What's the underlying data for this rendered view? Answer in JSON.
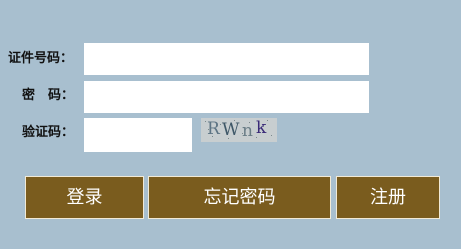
{
  "form": {
    "id_number_label": "证件号码：",
    "password_label": "密　码：",
    "captcha_label": "验证码：",
    "id_number_value": "",
    "password_value": "",
    "captcha_value": ""
  },
  "captcha_image": {
    "text": "RWnk",
    "chars": [
      "R",
      "W",
      "n",
      "k"
    ],
    "colors": [
      "#5d7484",
      "#3f5868",
      "#6a7d86",
      "#3a2a78"
    ]
  },
  "buttons": {
    "login_label": "登录",
    "forgot_password_label": "忘记密码",
    "register_label": "注册"
  },
  "colors": {
    "background": "#a8bfcf",
    "button_fill": "#7a5c1e",
    "button_text": "#ffffff",
    "field_fill": "#ffffff"
  }
}
